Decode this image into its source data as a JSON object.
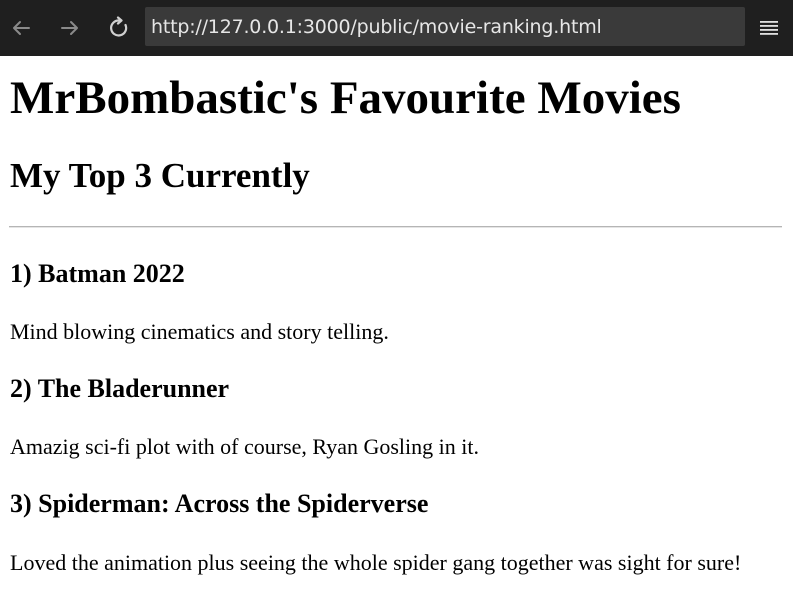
{
  "browser": {
    "url": "http://127.0.0.1:3000/public/movie-ranking.html"
  },
  "page": {
    "heading": "MrBombastic's Favourite Movies",
    "subheading": "My Top 3 Currently",
    "movies": [
      {
        "title": "1) Batman 2022",
        "description": "Mind blowing cinematics and story telling."
      },
      {
        "title": "2) The Bladerunner",
        "description": "Amazig sci-fi plot with of course, Ryan Gosling in it."
      },
      {
        "title": "3) Spiderman: Across the Spiderverse",
        "description": "Loved the animation plus seeing the whole spider gang together was sight for sure!"
      }
    ]
  }
}
